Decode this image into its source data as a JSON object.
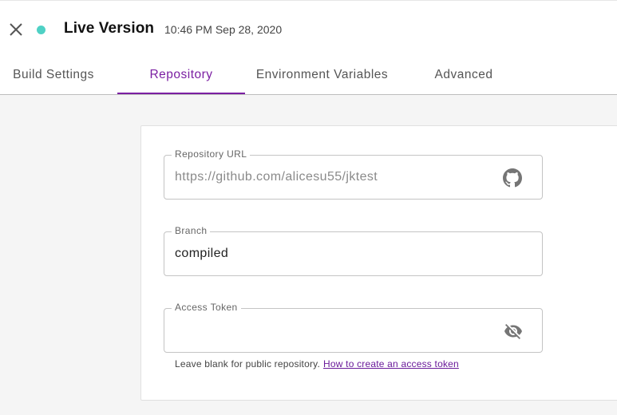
{
  "header": {
    "title": "Live Version",
    "timestamp": "10:46 PM Sep 28, 2020",
    "status_color": "#4fd1c5"
  },
  "tabs": [
    {
      "label": "Build Settings",
      "active": false
    },
    {
      "label": "Repository",
      "active": true
    },
    {
      "label": "Environment Variables",
      "active": false
    },
    {
      "label": "Advanced",
      "active": false
    }
  ],
  "form": {
    "repository_url": {
      "label": "Repository URL",
      "value": "https://github.com/alicesu55/jktest",
      "icon": "github-icon"
    },
    "branch": {
      "label": "Branch",
      "value": "compiled"
    },
    "access_token": {
      "label": "Access Token",
      "value": "",
      "icon": "eye-off-icon",
      "helper_text": "Leave blank for public repository.",
      "helper_link": "How to create an access token"
    }
  },
  "colors": {
    "accent": "#7b1fa2",
    "status": "#4fd1c5"
  }
}
